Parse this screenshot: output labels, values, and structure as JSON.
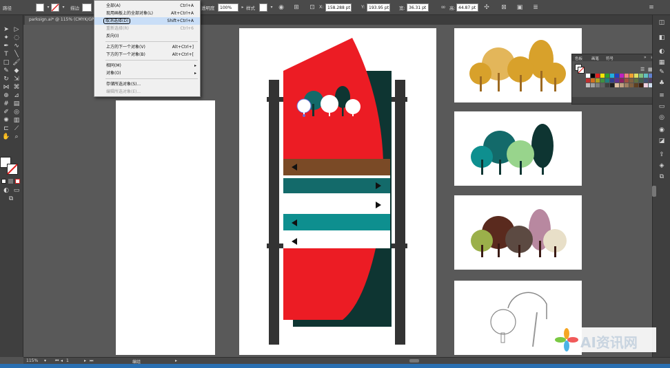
{
  "control_bar": {
    "path_label": "路径",
    "stroke_label": "描边",
    "opacity_label": "透明度",
    "opacity_value": "100%",
    "style_label": "样式",
    "x_value": "158.288 pt",
    "y_value": "193.95 pt",
    "w_value": "36.31 pt",
    "h_value": "44.87 pt"
  },
  "document_tab": "parksign.ai* @ 115% (CMYK/GPU",
  "menu": {
    "items": [
      {
        "label": "全部(A)",
        "shortcut": "Ctrl+A",
        "disabled": false
      },
      {
        "label": "现用画板上的全部对象(L)",
        "shortcut": "Alt+Ctrl+A",
        "disabled": false
      },
      {
        "label": "取消选择(D)",
        "shortcut": "Shift+Ctrl+A",
        "disabled": false
      },
      {
        "label": "重新选择(R)",
        "shortcut": "Ctrl+6",
        "disabled": true
      },
      {
        "label": "反向(I)",
        "shortcut": "",
        "disabled": false
      },
      {
        "label": "上方的下一个对象(V)",
        "shortcut": "Alt+Ctrl+]",
        "disabled": false
      },
      {
        "label": "下方的下一个对象(B)",
        "shortcut": "Alt+Ctrl+[",
        "disabled": false
      },
      {
        "label": "相同(M)",
        "shortcut": "",
        "disabled": false
      },
      {
        "label": "对象(O)",
        "shortcut": "",
        "disabled": false
      },
      {
        "label": "存储所选对象(S)...",
        "shortcut": "",
        "disabled": false
      },
      {
        "label": "编辑所选对象(E)...",
        "shortcut": "",
        "disabled": true
      }
    ]
  },
  "swatch_panel": {
    "tabs": [
      "色板",
      "画笔",
      "符号"
    ]
  },
  "status_bar": {
    "zoom": "115%",
    "page": "1",
    "tool_name": "编组"
  },
  "watermark": {
    "text": "AI资讯网"
  },
  "colors": {
    "sign_red": "#ec1c24",
    "sign_dark": "#0e3532",
    "post": "#333333",
    "band_brown": "#7a4a26",
    "band_teal": "#136a6a",
    "band_teal2": "#0e8f8f",
    "menu_highlight": "#c9def7"
  },
  "icons": {
    "tools": [
      "selection-tool-icon",
      "direct-selection-tool-icon",
      "magic-wand-icon",
      "lasso-icon",
      "pen-tool-icon",
      "curvature-icon",
      "type-tool-icon",
      "line-tool-icon",
      "rectangle-tool-icon",
      "paintbrush-icon",
      "pencil-icon",
      "eraser-icon",
      "rotate-icon",
      "scale-icon",
      "width-tool-icon",
      "warp-icon",
      "shape-builder-icon",
      "perspective-icon",
      "mesh-icon",
      "gradient-icon",
      "eyedropper-icon",
      "blend-icon",
      "symbol-sprayer-icon",
      "column-graph-icon",
      "artboard-tool-icon",
      "slice-icon",
      "hand-icon",
      "zoom-icon"
    ]
  }
}
